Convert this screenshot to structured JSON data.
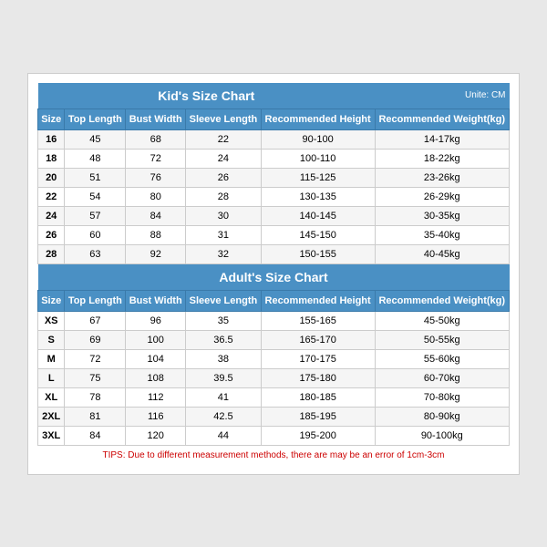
{
  "kids": {
    "title": "Kid's Size Chart",
    "unit": "Unite: CM",
    "columns": [
      "Size",
      "Top Length",
      "Bust Width",
      "Sleeve Length",
      "Recommended Height",
      "Recommended Weight(kg)"
    ],
    "rows": [
      [
        "16",
        "45",
        "68",
        "22",
        "90-100",
        "14-17kg"
      ],
      [
        "18",
        "48",
        "72",
        "24",
        "100-110",
        "18-22kg"
      ],
      [
        "20",
        "51",
        "76",
        "26",
        "115-125",
        "23-26kg"
      ],
      [
        "22",
        "54",
        "80",
        "28",
        "130-135",
        "26-29kg"
      ],
      [
        "24",
        "57",
        "84",
        "30",
        "140-145",
        "30-35kg"
      ],
      [
        "26",
        "60",
        "88",
        "31",
        "145-150",
        "35-40kg"
      ],
      [
        "28",
        "63",
        "92",
        "32",
        "150-155",
        "40-45kg"
      ]
    ]
  },
  "adults": {
    "title": "Adult's Size Chart",
    "columns": [
      "Size",
      "Top Length",
      "Bust Width",
      "Sleeve Length",
      "Recommended Height",
      "Recommended Weight(kg)"
    ],
    "rows": [
      [
        "XS",
        "67",
        "96",
        "35",
        "155-165",
        "45-50kg"
      ],
      [
        "S",
        "69",
        "100",
        "36.5",
        "165-170",
        "50-55kg"
      ],
      [
        "M",
        "72",
        "104",
        "38",
        "170-175",
        "55-60kg"
      ],
      [
        "L",
        "75",
        "108",
        "39.5",
        "175-180",
        "60-70kg"
      ],
      [
        "XL",
        "78",
        "112",
        "41",
        "180-185",
        "70-80kg"
      ],
      [
        "2XL",
        "81",
        "116",
        "42.5",
        "185-195",
        "80-90kg"
      ],
      [
        "3XL",
        "84",
        "120",
        "44",
        "195-200",
        "90-100kg"
      ]
    ]
  },
  "tips": "TIPS: Due to different measurement methods, there are may be an error of 1cm-3cm"
}
